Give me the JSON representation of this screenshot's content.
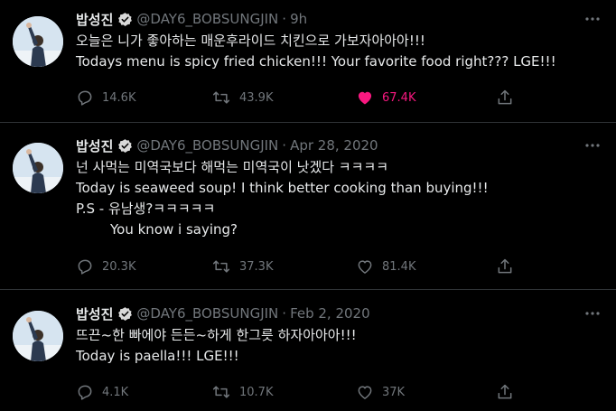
{
  "tweets": [
    {
      "display_name": "밥성진",
      "handle": "@DAY6_BOBSUNGJIN",
      "separator": "·",
      "time": "9h",
      "lines": [
        "오늘은 니가 좋아하는 매운후라이드 치킨으로 가보자아아아!!!",
        "Todays menu is spicy fried chicken!!! Your favorite food right??? LGE!!!"
      ],
      "replies": "14.6K",
      "retweets": "43.9K",
      "likes": "67.4K",
      "liked": true
    },
    {
      "display_name": "밥성진",
      "handle": "@DAY6_BOBSUNGJIN",
      "separator": "·",
      "time": "Apr 28, 2020",
      "lines": [
        "넌 사먹는 미역국보다 해먹는 미역국이 낫겠다 ㅋㅋㅋㅋ",
        "Today is seaweed soup! I think better cooking than buying!!!",
        "P.S - 유남생?ㅋㅋㅋㅋㅋ",
        "You know i saying?"
      ],
      "replies": "20.3K",
      "retweets": "37.3K",
      "likes": "81.4K",
      "liked": false
    },
    {
      "display_name": "밥성진",
      "handle": "@DAY6_BOBSUNGJIN",
      "separator": "·",
      "time": "Feb 2, 2020",
      "lines": [
        "뜨끈~한 빠에야 든든~하게 한그릇 하자아아아!!!",
        "Today is paella!!! LGE!!!"
      ],
      "replies": "4.1K",
      "retweets": "10.7K",
      "likes": "37K",
      "liked": false
    }
  ],
  "colors": {
    "background": "#000000",
    "text": "#e7e9ea",
    "muted": "#71767b",
    "like": "#f91880",
    "verified_badge": "#d9d9d9",
    "divider": "#2f3336"
  },
  "icons": {
    "verified": "verified-badge-icon",
    "more": "more-options-icon",
    "reply": "reply-icon",
    "retweet": "retweet-icon",
    "like": "heart-icon",
    "share": "share-icon"
  }
}
